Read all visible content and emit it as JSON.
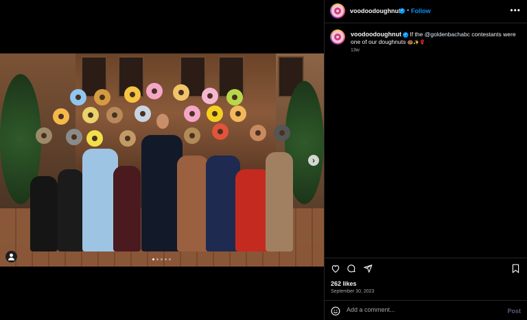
{
  "post": {
    "username": "voodoodoughnut",
    "verified_icon": "verified-badge-icon",
    "separator": "•",
    "follow_label": "Follow",
    "more_label": "•••",
    "caption_username": "voodoodoughnut",
    "caption_text_pre": "If the ",
    "caption_mention": "@goldenbachabc",
    "caption_text_post": " contestants were one of our doughnuts",
    "caption_emoji": "🍩✨🌹",
    "time_ago": "13w",
    "likes": "262 likes",
    "date": "September 30, 2023"
  },
  "media": {
    "next_label": "›",
    "carousel_count": 5,
    "carousel_active": 1,
    "accent_colors": {
      "donut_pink": "#f4a6c8",
      "donut_yellow": "#f5c542",
      "donut_blue": "#8fc6f0",
      "donut_rainbow": "#e2533b"
    }
  },
  "comment_box": {
    "placeholder": "Add a comment...",
    "post_label": "Post"
  },
  "colors": {
    "background": "#000000",
    "accent": "#0095f6",
    "secondary_text": "#a8a8a8",
    "divider": "#262626"
  }
}
